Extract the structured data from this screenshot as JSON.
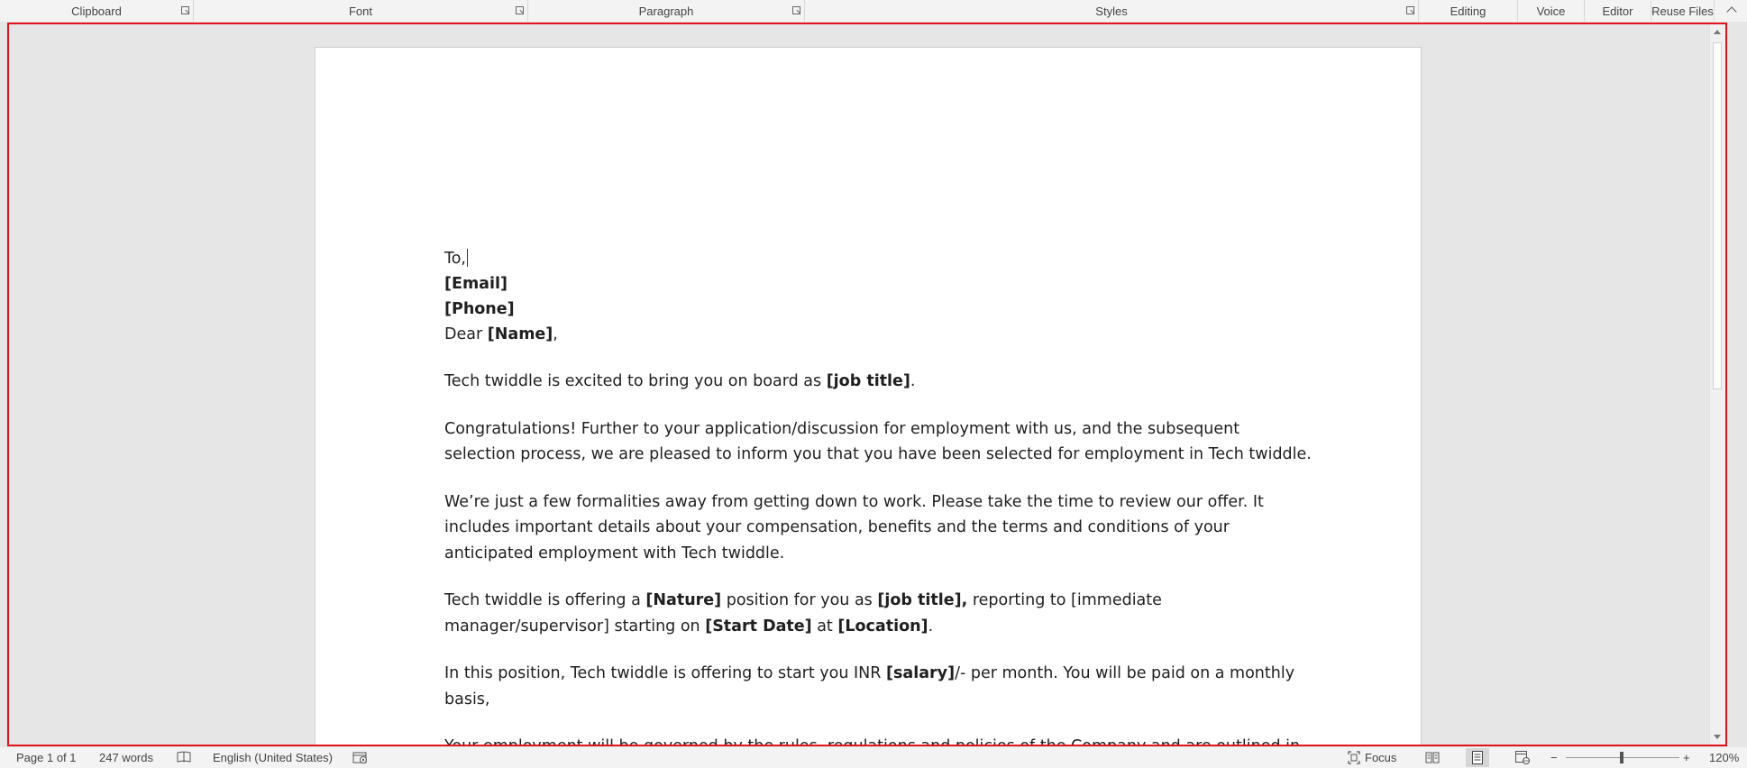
{
  "ribbon": {
    "groups": {
      "clipboard": "Clipboard",
      "font": "Font",
      "paragraph": "Paragraph",
      "styles": "Styles",
      "editing": "Editing",
      "voice": "Voice",
      "editor": "Editor",
      "reuse_files": "Reuse Files"
    }
  },
  "document": {
    "to": "To,",
    "email": "[Email]",
    "phone": "[Phone]",
    "dear_prefix": "Dear ",
    "dear_name": "[Name]",
    "dear_suffix": ",",
    "p1": {
      "pre": "Tech twiddle is excited to bring you on board as ",
      "job": "[job title]",
      "post": "."
    },
    "p2": {
      "line1": "Congratulations! Further to your application/discussion for employment with us, and the subsequent",
      "line2": "selection process, we are pleased to inform you that you have been selected for employment in Tech twiddle."
    },
    "p3": {
      "line1": "We’re just a few formalities away from getting down to work. Please take the time to review our offer. It",
      "line2": "includes important details about your compensation, benefits and the terms and conditions of your",
      "line3": "anticipated employment with Tech twiddle."
    },
    "p4": {
      "a": "Tech twiddle is offering a ",
      "nature": "[Nature]",
      "b": " position for you as ",
      "job": "[job title],",
      "c": " reporting to [immediate",
      "d": "manager/supervisor] starting on ",
      "start": "[Start Date]",
      "e": " at ",
      "location": "[Location]",
      "f": "."
    },
    "p5": {
      "a": "In this position, Tech twiddle is offering to start you INR ",
      "salary": "[salary]",
      "b": "/- per month. You will be paid on a monthly",
      "line2": "basis,"
    },
    "p6": {
      "line1": "Your employment will be governed by the rules, regulations and policies of the Company and are outlined in"
    }
  },
  "statusbar": {
    "page": "Page 1 of 1",
    "words": "247 words",
    "language": "English (United States)",
    "focus": "Focus",
    "zoom": "120%",
    "zoom_minus": "−",
    "zoom_plus": "+"
  }
}
